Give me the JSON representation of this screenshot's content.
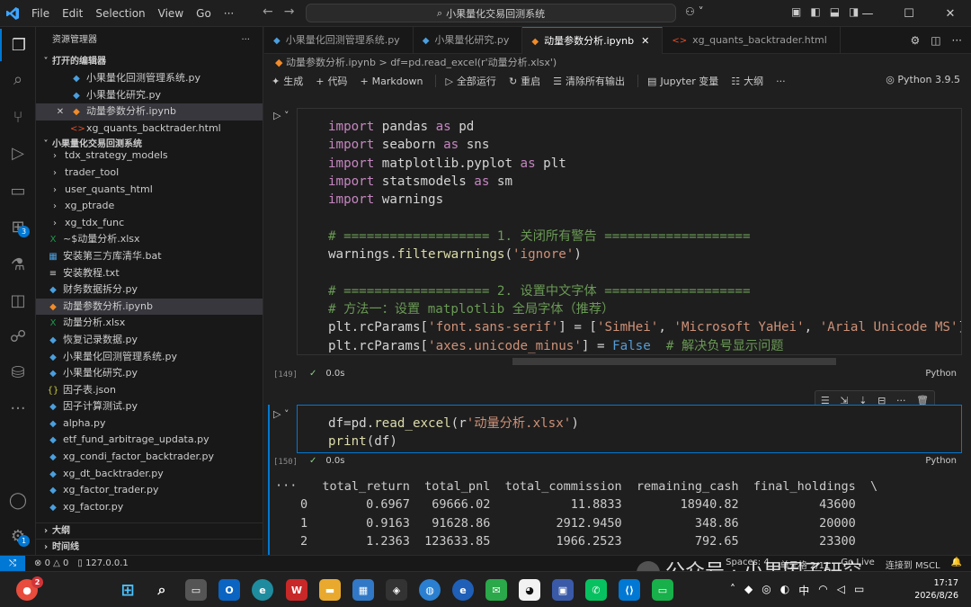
{
  "titlebar": {
    "menus": [
      "File",
      "Edit",
      "Selection",
      "View",
      "Go"
    ],
    "more": "···",
    "search": "小果量化交易回测系统"
  },
  "activity": {
    "extensions_badge": "3",
    "settings_badge": "1"
  },
  "sidebar": {
    "title": "资源管理器",
    "more": "···",
    "open_editors_label": "打开的编辑器",
    "open_editors": [
      {
        "name": "小果量化回测管理系统.py",
        "type": "py"
      },
      {
        "name": "小果量化研究.py",
        "type": "py"
      },
      {
        "name": "动量参数分析.ipynb",
        "type": "ipynb"
      },
      {
        "name": "xg_quants_backtrader.html",
        "type": "html"
      }
    ],
    "project_label": "小果量化交易回测系统",
    "files": [
      {
        "name": "tdx_strategy_models",
        "type": "folder"
      },
      {
        "name": "trader_tool",
        "type": "folder"
      },
      {
        "name": "user_quants_html",
        "type": "folder"
      },
      {
        "name": "xg_ptrade",
        "type": "folder"
      },
      {
        "name": "xg_tdx_func",
        "type": "folder"
      },
      {
        "name": "~$动量分析.xlsx",
        "type": "xlsx"
      },
      {
        "name": "安装第三方库清华.bat",
        "type": "bat"
      },
      {
        "name": "安装教程.txt",
        "type": "txt"
      },
      {
        "name": "财务数据拆分.py",
        "type": "py"
      },
      {
        "name": "动量参数分析.ipynb",
        "type": "ipynb"
      },
      {
        "name": "动量分析.xlsx",
        "type": "xlsx"
      },
      {
        "name": "恢复记录数据.py",
        "type": "py"
      },
      {
        "name": "小果量化回测管理系统.py",
        "type": "py"
      },
      {
        "name": "小果量化研究.py",
        "type": "py"
      },
      {
        "name": "因子表.json",
        "type": "json"
      },
      {
        "name": "因子计算测试.py",
        "type": "py"
      },
      {
        "name": "alpha.py",
        "type": "py"
      },
      {
        "name": "etf_fund_arbitrage_updata.py",
        "type": "py"
      },
      {
        "name": "xg_condi_factor_backtrader.py",
        "type": "py"
      },
      {
        "name": "xg_dt_backtrader.py",
        "type": "py"
      },
      {
        "name": "xg_factor_trader.py",
        "type": "py"
      },
      {
        "name": "xg_factor.py",
        "type": "py"
      }
    ],
    "outline_label": "大纲",
    "timeline_label": "时间线"
  },
  "tabs": [
    {
      "label": "小果量化回测管理系统.py",
      "type": "py"
    },
    {
      "label": "小果量化研究.py",
      "type": "py"
    },
    {
      "label": "动量参数分析.ipynb",
      "type": "ipynb"
    },
    {
      "label": "xg_quants_backtrader.html",
      "type": "html"
    }
  ],
  "breadcrumb": {
    "file": "动量参数分析.ipynb",
    "sep": ">",
    "cell": "df=pd.read_excel(r'动量分析.xlsx')"
  },
  "toolbar": {
    "generate": "生成",
    "code": "代码",
    "markdown": "Markdown",
    "run_all": "全部运行",
    "restart": "重启",
    "clear_all": "清除所有输出",
    "jupyter_vars": "Jupyter 变量",
    "outline": "大纲",
    "more": "···",
    "kernel": "Python 3.9.5"
  },
  "mini_actions": {
    "generate": "生成",
    "code": "代码"
  },
  "cell1": {
    "exec": "[149]",
    "time": "0.0s",
    "lang": "Python"
  },
  "cell2": {
    "exec": "[150]",
    "time": "0.0s",
    "lang": "Python"
  },
  "output": {
    "dots": "···",
    "header": "   total_return  total_pnl  total_commission  remaining_cash  final_holdings  \\",
    "rows": [
      "0        0.6967   69666.02           11.8833        18940.82           43600",
      "1        0.9163   91628.86         2912.9450          348.86           20000",
      "2        1.2363  123633.85         1966.2523          792.65           23300"
    ]
  },
  "statusbar": {
    "errors": "0",
    "warnings": "0",
    "host": "127.0.0.1",
    "spaces": "Spaces: 4",
    "cell_pos": "单元格 2/11",
    "golive": "Go Live",
    "connect": "连接到 MSCL"
  },
  "watermark": "公众号 · 小果因子研究",
  "taskbar": {
    "notif_count": "2",
    "ime": "中",
    "time": "17:17",
    "date": "2026/8/26"
  }
}
